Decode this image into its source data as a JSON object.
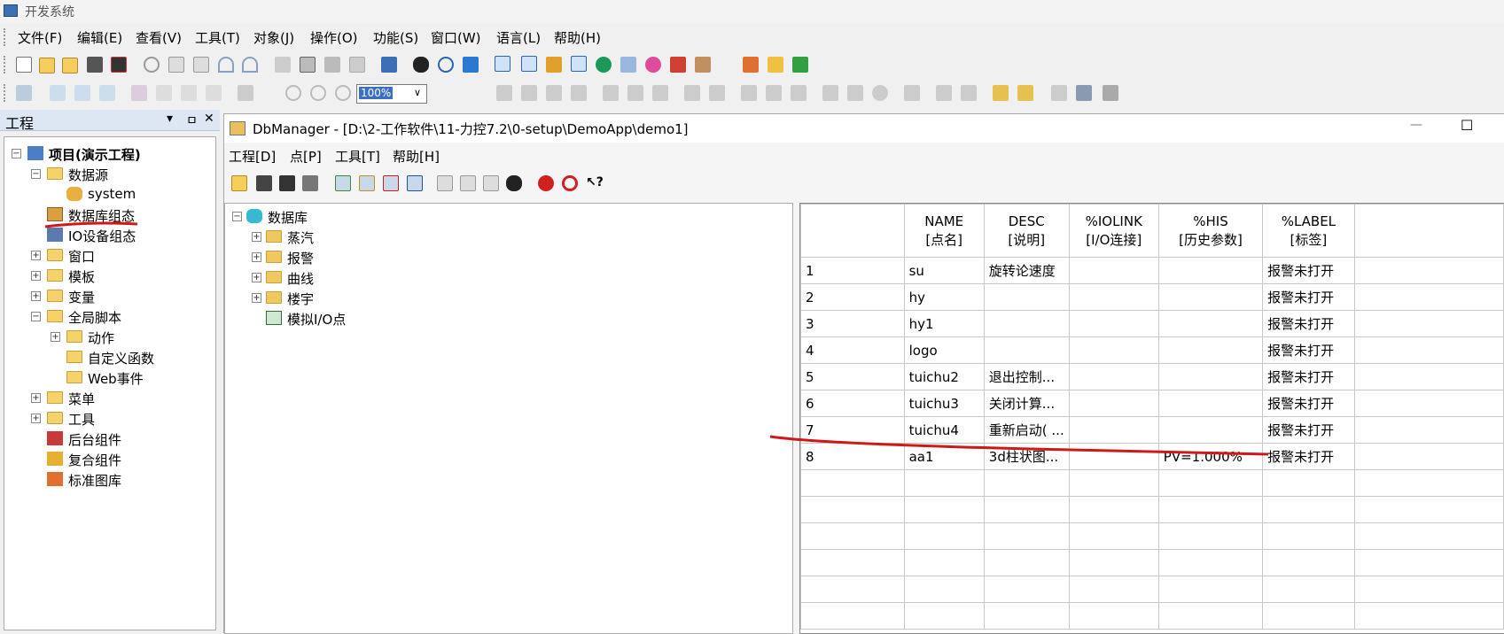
{
  "app": {
    "title": "开发系统"
  },
  "menu": [
    "文件(F)",
    "编辑(E)",
    "查看(V)",
    "工具(T)",
    "对象(J)",
    "操作(O)",
    "功能(S)",
    "窗口(W)",
    "语言(L)",
    "帮助(H)"
  ],
  "toolbar": {
    "zoom_value": "100%"
  },
  "project_pane": {
    "title": "工程",
    "pin": "ㅁ",
    "close": "✕",
    "dropdown": "▾",
    "tree": [
      {
        "label": "项目(演示工程)",
        "level": 0,
        "bold": true
      },
      {
        "label": "数据源",
        "level": 1
      },
      {
        "label": "system",
        "level": 2
      },
      {
        "label": "数据库组态",
        "level": 1
      },
      {
        "label": "IO设备组态",
        "level": 1
      },
      {
        "label": "窗口",
        "level": 1
      },
      {
        "label": "模板",
        "level": 1
      },
      {
        "label": "变量",
        "level": 1
      },
      {
        "label": "全局脚本",
        "level": 1
      },
      {
        "label": "动作",
        "level": 2
      },
      {
        "label": "自定义函数",
        "level": 2
      },
      {
        "label": "Web事件",
        "level": 2
      },
      {
        "label": "菜单",
        "level": 1
      },
      {
        "label": "工具",
        "level": 1
      },
      {
        "label": "后台组件",
        "level": 1
      },
      {
        "label": "复合组件",
        "level": 1
      },
      {
        "label": "标准图库",
        "level": 1
      }
    ]
  },
  "dbmanager": {
    "title": "DbManager - [D:\\2-工作软件\\11-力控7.2\\0-setup\\DemoApp\\demo1]",
    "min": "—",
    "max": "☐",
    "menu": [
      "工程[D]",
      "点[P]",
      "工具[T]",
      "帮助[H]"
    ],
    "tree": {
      "root": "数据库",
      "children": [
        "蒸汽",
        "报警",
        "曲线",
        "楼宇",
        "模拟I/O点"
      ]
    },
    "grid": {
      "columns": [
        {
          "l1": "NAME",
          "l2": "[点名]"
        },
        {
          "l1": "DESC",
          "l2": "[说明]"
        },
        {
          "l1": "%IOLINK",
          "l2": "[I/O连接]"
        },
        {
          "l1": "%HIS",
          "l2": "[历史参数]"
        },
        {
          "l1": "%LABEL",
          "l2": "[标签]"
        }
      ],
      "rows": [
        [
          "1",
          "su",
          "旋转论速度",
          "",
          "",
          "报警未打开"
        ],
        [
          "2",
          "hy",
          "",
          "",
          "",
          "报警未打开"
        ],
        [
          "3",
          "hy1",
          "",
          "",
          "",
          "报警未打开"
        ],
        [
          "4",
          "logo",
          "",
          "",
          "",
          "报警未打开"
        ],
        [
          "5",
          "tuichu2",
          "退出控制...",
          "",
          "",
          "报警未打开"
        ],
        [
          "6",
          "tuichu3",
          "关闭计算...",
          "",
          "",
          "报警未打开"
        ],
        [
          "7",
          "tuichu4",
          "重新启动( ...",
          "",
          "",
          "报警未打开"
        ],
        [
          "8",
          "aa1",
          "3d柱状图...",
          "",
          "PV=1.000%",
          "报警未打开"
        ]
      ],
      "empty_rows": 6
    }
  },
  "colors": {
    "annotation": "#d01818",
    "header_bg": "#dde7f3"
  }
}
